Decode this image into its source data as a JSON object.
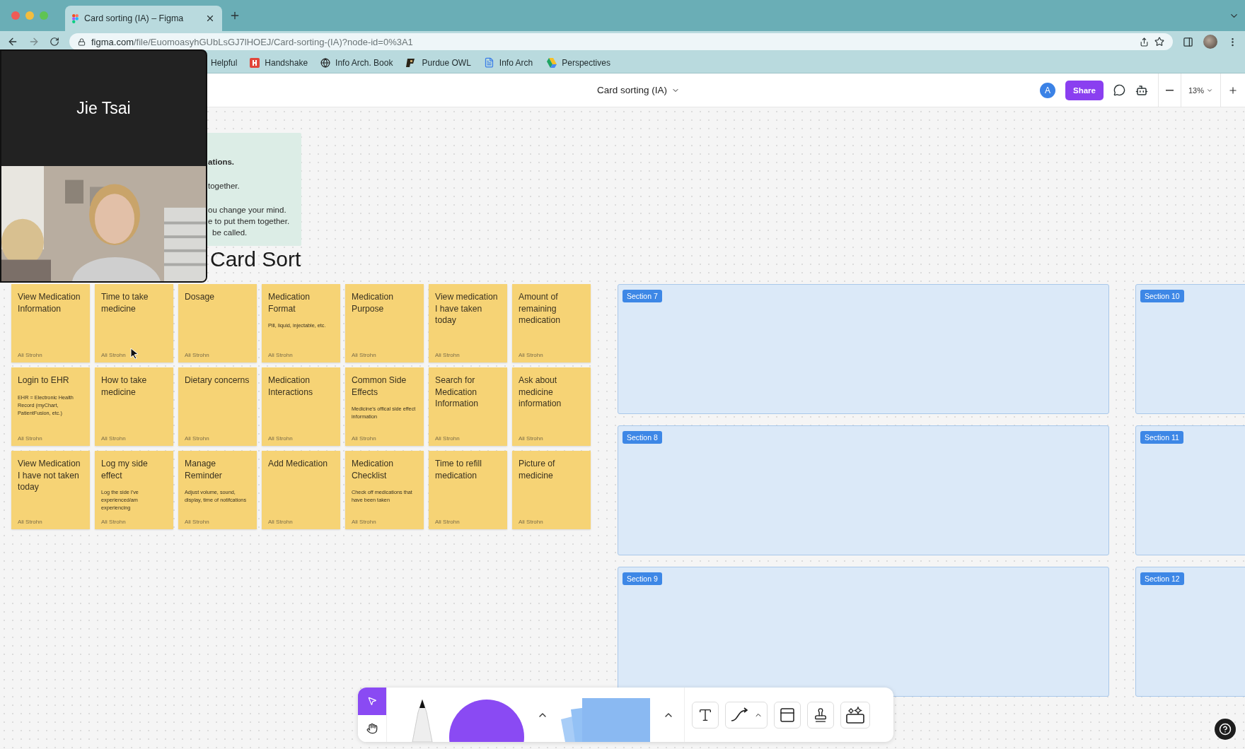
{
  "browser": {
    "tab": {
      "title": "Card sorting (IA) – Figma"
    },
    "url": {
      "domain": "figma.com",
      "path": "/file/EuomoasyhGUbLsGJ7lHOEJ/Card-sorting-(IA)?node-id=0%3A1"
    },
    "bookmarks": [
      {
        "label": "Helpful",
        "kind": "hidden"
      },
      {
        "label": "Handshake",
        "kind": "handshake"
      },
      {
        "label": "Info Arch. Book",
        "kind": "globe"
      },
      {
        "label": "Purdue OWL",
        "kind": "purdue"
      },
      {
        "label": "Info Arch",
        "kind": "doc"
      },
      {
        "label": "Perspectives",
        "kind": "drive"
      }
    ]
  },
  "figma": {
    "file_title": "Card sorting (IA)",
    "avatar": "A",
    "share": "Share",
    "zoom": "13%"
  },
  "video_call": {
    "name": "Jie Tsai"
  },
  "instructions": {
    "lines": [
      {
        "text": "ations.",
        "bold": true
      },
      {
        "text": "together.",
        "bold": false
      },
      {
        "text": "ou change your mind.",
        "bold": false
      },
      {
        "text": "e to put them together.",
        "bold": false
      },
      {
        "text": "be called.",
        "bold": false
      }
    ]
  },
  "heading": "Card Sort",
  "cards": [
    {
      "title": "View Medication Information",
      "author": "Ali Strohn"
    },
    {
      "title": "Time to take medicine",
      "author": "Ali Strohn"
    },
    {
      "title": "Dosage",
      "author": "Ali Strohn"
    },
    {
      "title": "Medication Format",
      "note": "Pill, liquid, injectable, etc.",
      "author": "Ali Strohn"
    },
    {
      "title": "Medication Purpose",
      "author": "Ali Strohn"
    },
    {
      "title": "View medication I have taken today",
      "author": "Ali Strohn"
    },
    {
      "title": "Amount of remaining medication",
      "author": "Ali Strohn"
    },
    {
      "title": "Login to EHR",
      "note": "EHR = Electronic Health Record (myChart, PatientFusion, etc.)",
      "author": "Ali Strohn"
    },
    {
      "title": "How to take medicine",
      "author": "Ali Strohn"
    },
    {
      "title": "Dietary concerns",
      "author": "Ali Strohn"
    },
    {
      "title": "Medication Interactions",
      "author": "Ali Strohn"
    },
    {
      "title": "Common Side Effects",
      "note": "Medicine's offical side effect information",
      "author": "Ali Strohn"
    },
    {
      "title": "Search for Medication Information",
      "author": "Ali Strohn"
    },
    {
      "title": "Ask about medicine information",
      "author": "Ali Strohn"
    },
    {
      "title": "View Medication I have not taken today",
      "author": "Ali Strohn"
    },
    {
      "title": "Log my side effect",
      "note": "Log the side I've experienced/am experiencing",
      "author": "Ali Strohn"
    },
    {
      "title": "Manage Reminder",
      "note": "Adjust volume, sound, display, time of notifcations",
      "author": "Ali Strohn"
    },
    {
      "title": "Add Medication",
      "author": "Ali Strohn"
    },
    {
      "title": "Medication Checklist",
      "note": "Check off medications that have been taken",
      "author": "Ali Strohn"
    },
    {
      "title": "Time to refill medication",
      "author": "Ali Strohn"
    },
    {
      "title": "Picture of medicine",
      "author": "Ali Strohn"
    }
  ],
  "sections": [
    {
      "label": "Section 7"
    },
    {
      "label": "Section 8"
    },
    {
      "label": "Section 9"
    },
    {
      "label": "Section 10"
    },
    {
      "label": "Section 11"
    },
    {
      "label": "Section 12"
    }
  ],
  "toolbar": {
    "tools": [
      {
        "kind": "move",
        "selected": true
      },
      {
        "kind": "hand",
        "selected": false
      }
    ]
  }
}
